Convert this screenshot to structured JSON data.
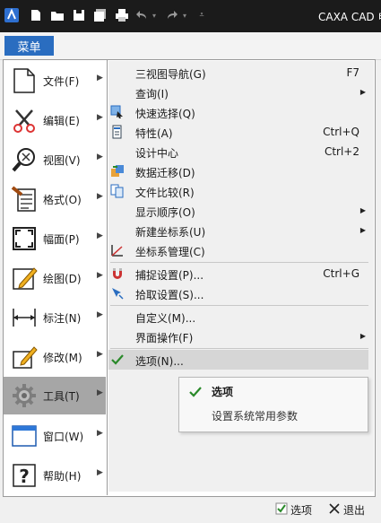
{
  "titlebar": {
    "app_title": "CAXA CAD 电",
    "quick_access": [
      "new-file-icon",
      "open-folder-icon",
      "save-icon",
      "save-all-icon",
      "print-icon",
      "undo-icon",
      "redo-icon",
      "customize-dropdown-icon"
    ]
  },
  "menu_button": "菜单",
  "categories": [
    {
      "label": "文件(F)",
      "icon": "file-icon"
    },
    {
      "label": "编辑(E)",
      "icon": "scissors-icon"
    },
    {
      "label": "视图(V)",
      "icon": "zoom-icon"
    },
    {
      "label": "格式(O)",
      "icon": "format-icon"
    },
    {
      "label": "幅面(P)",
      "icon": "frame-icon"
    },
    {
      "label": "绘图(D)",
      "icon": "draw-pencil-icon"
    },
    {
      "label": "标注(N)",
      "icon": "dimension-icon"
    },
    {
      "label": "修改(M)",
      "icon": "modify-icon"
    },
    {
      "label": "工具(T)",
      "icon": "gear-icon",
      "active": true
    },
    {
      "label": "窗口(W)",
      "icon": "window-icon"
    },
    {
      "label": "帮助(H)",
      "icon": "help-icon"
    }
  ],
  "tools_menu": [
    {
      "label": "三视图导航(G)",
      "shortcut": "F7"
    },
    {
      "label": "查询(I)",
      "submenu": true
    },
    {
      "label": "快速选择(Q)",
      "icon": "quick-select-icon"
    },
    {
      "label": "特性(A)",
      "shortcut": "Ctrl+Q",
      "icon": "properties-icon"
    },
    {
      "label": "设计中心",
      "shortcut": "Ctrl+2"
    },
    {
      "label": "数据迁移(D)",
      "icon": "data-migrate-icon"
    },
    {
      "label": "文件比较(R)",
      "icon": "file-compare-icon"
    },
    {
      "label": "显示顺序(O)",
      "submenu": true
    },
    {
      "label": "新建坐标系(U)",
      "submenu": true
    },
    {
      "label": "坐标系管理(C)",
      "icon": "coordinate-icon"
    },
    {
      "label": "捕捉设置(P)...",
      "shortcut": "Ctrl+G",
      "icon": "magnet-icon"
    },
    {
      "label": "拾取设置(S)...",
      "icon": "pick-settings-icon"
    },
    {
      "label": "自定义(M)..."
    },
    {
      "label": "界面操作(F)",
      "submenu": true
    },
    {
      "label": "选项(N)...",
      "icon": "options-check-icon",
      "highlighted": true
    }
  ],
  "tooltip": {
    "title": "选项",
    "description": "设置系统常用参数"
  },
  "bottom": {
    "options_label": "选项",
    "exit_label": "退出"
  },
  "colors": {
    "titlebar": "#1b1b1b",
    "menu_button": "#2a6dc0",
    "active_category": "#a6a6a6",
    "highlight": "#d6d6d6"
  }
}
